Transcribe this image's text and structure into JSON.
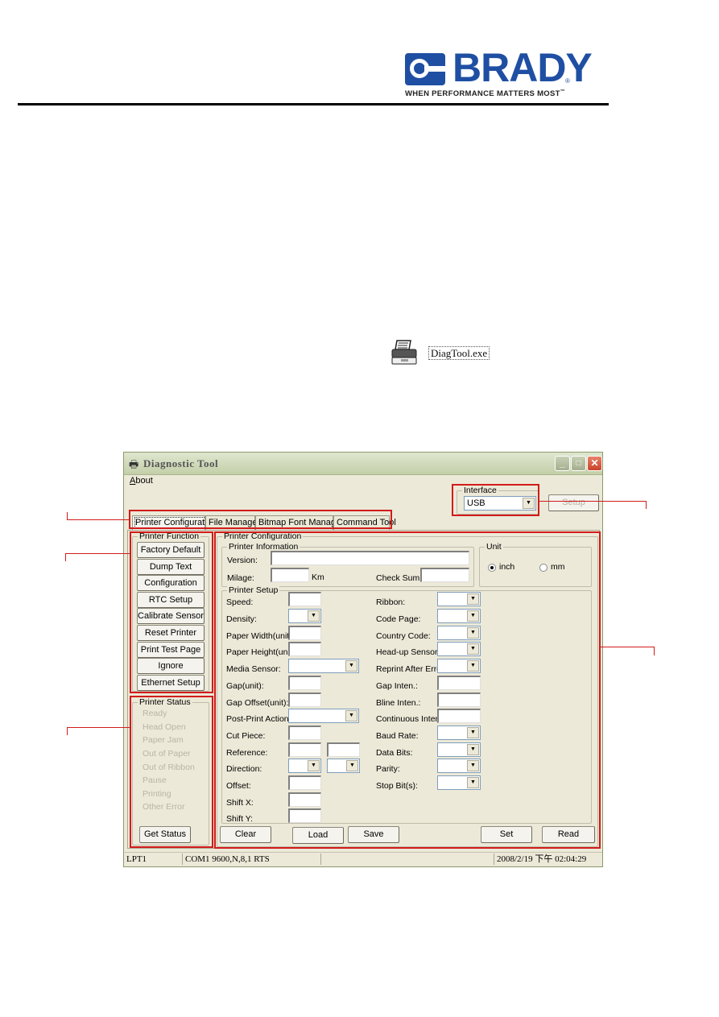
{
  "header": {
    "brand": "BRADY",
    "tagline": "WHEN PERFORMANCE MATTERS MOST",
    "tagline_tm": "™",
    "registered": "®",
    "brand_color": "#1f4fa3"
  },
  "exe_file": {
    "icon": "printer-icon",
    "label": "DiagTool.exe"
  },
  "window": {
    "title": "Diagnostic Tool",
    "title_icon": "printer-icon",
    "controls": {
      "minimize": "_",
      "maximize": "□",
      "close": "✕"
    },
    "menu": {
      "about": "About",
      "about_accel": "A",
      "about_rest": "bout"
    },
    "interface": {
      "label": "Interface",
      "value": "USB",
      "setup_button": "Setup"
    },
    "tabs": [
      {
        "label": "Printer Configuration",
        "active": true
      },
      {
        "label": "File Manager",
        "active": false
      },
      {
        "label": "Bitmap Font Manager",
        "active": false
      },
      {
        "label": "Command Tool",
        "active": false
      }
    ],
    "printer_function": {
      "label": "Printer Function",
      "buttons": [
        "Factory Default",
        "Dump Text",
        "Configuration Page",
        "RTC Setup",
        "Calibrate Sensor",
        "Reset Printer",
        "Print Test Page",
        "Ignore AUTO.BAS",
        "Ethernet Setup"
      ]
    },
    "printer_status": {
      "label": "Printer Status",
      "items": [
        "Ready",
        "Head Open",
        "Paper Jam",
        "Out of Paper",
        "Out of Ribbon",
        "Pause",
        "Printing",
        "Other Error"
      ],
      "get_status_button": "Get Status"
    },
    "printer_configuration": {
      "label": "Printer Configuration",
      "printer_information": {
        "label": "Printer Information",
        "version_label": "Version:",
        "version_value": "",
        "milage_label": "Milage:",
        "milage_value": "",
        "milage_unit": "Km",
        "checksum_label": "Check Sum:",
        "checksum_value": ""
      },
      "unit": {
        "label": "Unit",
        "options": [
          "inch",
          "mm"
        ],
        "selected": "inch"
      },
      "printer_setup": {
        "label": "Printer Setup",
        "left_fields": [
          {
            "label": "Speed:",
            "type": "text"
          },
          {
            "label": "Density:",
            "type": "combo"
          },
          {
            "label": "Paper Width(unit):",
            "type": "text"
          },
          {
            "label": "Paper Height(unit):",
            "type": "text"
          },
          {
            "label": "Media Sensor:",
            "type": "combo-wide"
          },
          {
            "label": "Gap(unit):",
            "type": "text"
          },
          {
            "label": "Gap Offset(unit):",
            "type": "text"
          },
          {
            "label": "Post-Print Action:",
            "type": "combo-wide"
          },
          {
            "label": "Cut Piece:",
            "type": "text"
          },
          {
            "label": "Reference:",
            "type": "text-pair"
          },
          {
            "label": "Direction:",
            "type": "combo-pair"
          },
          {
            "label": "Offset:",
            "type": "text"
          },
          {
            "label": "Shift X:",
            "type": "text"
          },
          {
            "label": "Shift Y:",
            "type": "text"
          }
        ],
        "right_fields": [
          {
            "label": "Ribbon:",
            "type": "combo"
          },
          {
            "label": "Code Page:",
            "type": "combo"
          },
          {
            "label": "Country Code:",
            "type": "combo"
          },
          {
            "label": "Head-up Sensor:",
            "type": "combo"
          },
          {
            "label": "Reprint After Error:",
            "type": "combo"
          },
          {
            "label": "Gap Inten.:",
            "type": "text"
          },
          {
            "label": "Bline Inten.:",
            "type": "text"
          },
          {
            "label": "Continuous Inten.:",
            "type": "text"
          },
          {
            "label": "Baud Rate:",
            "type": "combo"
          },
          {
            "label": "Data Bits:",
            "type": "combo"
          },
          {
            "label": "Parity:",
            "type": "combo"
          },
          {
            "label": "Stop Bit(s):",
            "type": "combo"
          }
        ]
      },
      "buttons": {
        "clear": "Clear",
        "load": "Load",
        "save": "Save",
        "set": "Set",
        "read": "Read"
      }
    },
    "statusbar": {
      "port": "LPT1",
      "com": "COM1 9600,N,8,1 RTS",
      "empty": "",
      "datetime": "2008/2/19 下午 02:04:29"
    }
  },
  "annotation_color": "#d21b1b"
}
